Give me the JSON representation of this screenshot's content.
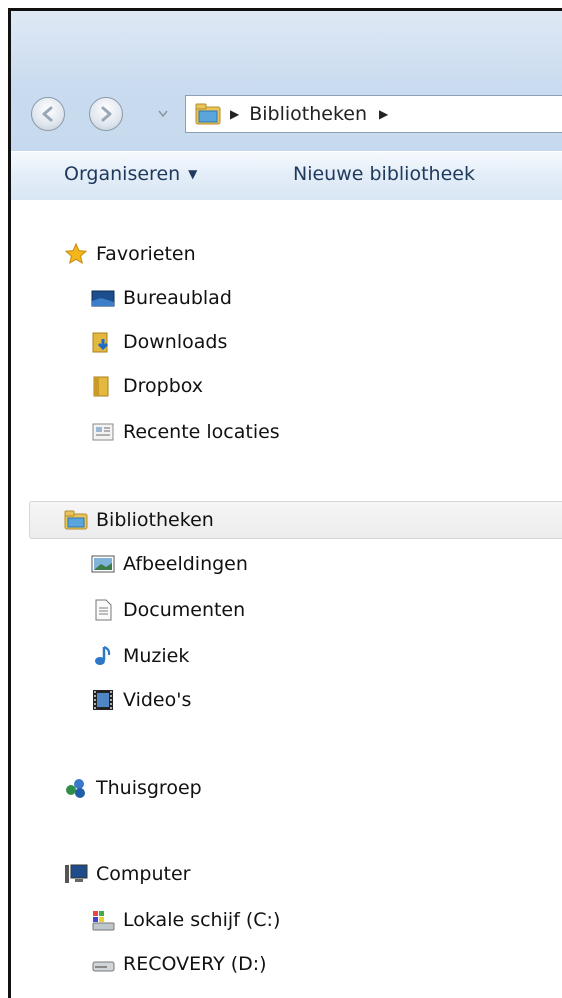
{
  "window": {
    "nav": {
      "back_icon": "back-arrow-icon",
      "forward_icon": "forward-arrow-icon",
      "dropdown_icon": "chevron-down-icon"
    },
    "address": {
      "icon": "libraries-folder-icon",
      "location": "Bibliotheken",
      "separator": "▶"
    }
  },
  "toolbar": {
    "organize_label": "Organiseren",
    "organize_caret": "▼",
    "new_library_label": "Nieuwe bibliotheek"
  },
  "navigation": {
    "favorites": {
      "label": "Favorieten",
      "icon": "star-icon",
      "items": [
        {
          "label": "Bureaublad",
          "icon": "desktop-icon"
        },
        {
          "label": "Downloads",
          "icon": "downloads-folder-icon"
        },
        {
          "label": "Dropbox",
          "icon": "folder-icon"
        },
        {
          "label": "Recente locaties",
          "icon": "recent-places-icon"
        }
      ]
    },
    "libraries": {
      "label": "Bibliotheken",
      "icon": "libraries-folder-icon",
      "selected": true,
      "items": [
        {
          "label": "Afbeeldingen",
          "icon": "pictures-icon"
        },
        {
          "label": "Documenten",
          "icon": "documents-icon"
        },
        {
          "label": "Muziek",
          "icon": "music-note-icon"
        },
        {
          "label": "Video's",
          "icon": "film-icon"
        }
      ]
    },
    "homegroup": {
      "label": "Thuisgroep",
      "icon": "homegroup-icon"
    },
    "computer": {
      "label": "Computer",
      "icon": "computer-icon",
      "items": [
        {
          "label": "Lokale schijf (C:)",
          "icon": "system-drive-icon"
        },
        {
          "label": "RECOVERY (D:)",
          "icon": "hard-drive-icon"
        }
      ]
    }
  },
  "colors": {
    "title_gradient_top": "#dfe9f5",
    "toolbar_text": "#1e395b",
    "selected_bg": "#ececec"
  }
}
